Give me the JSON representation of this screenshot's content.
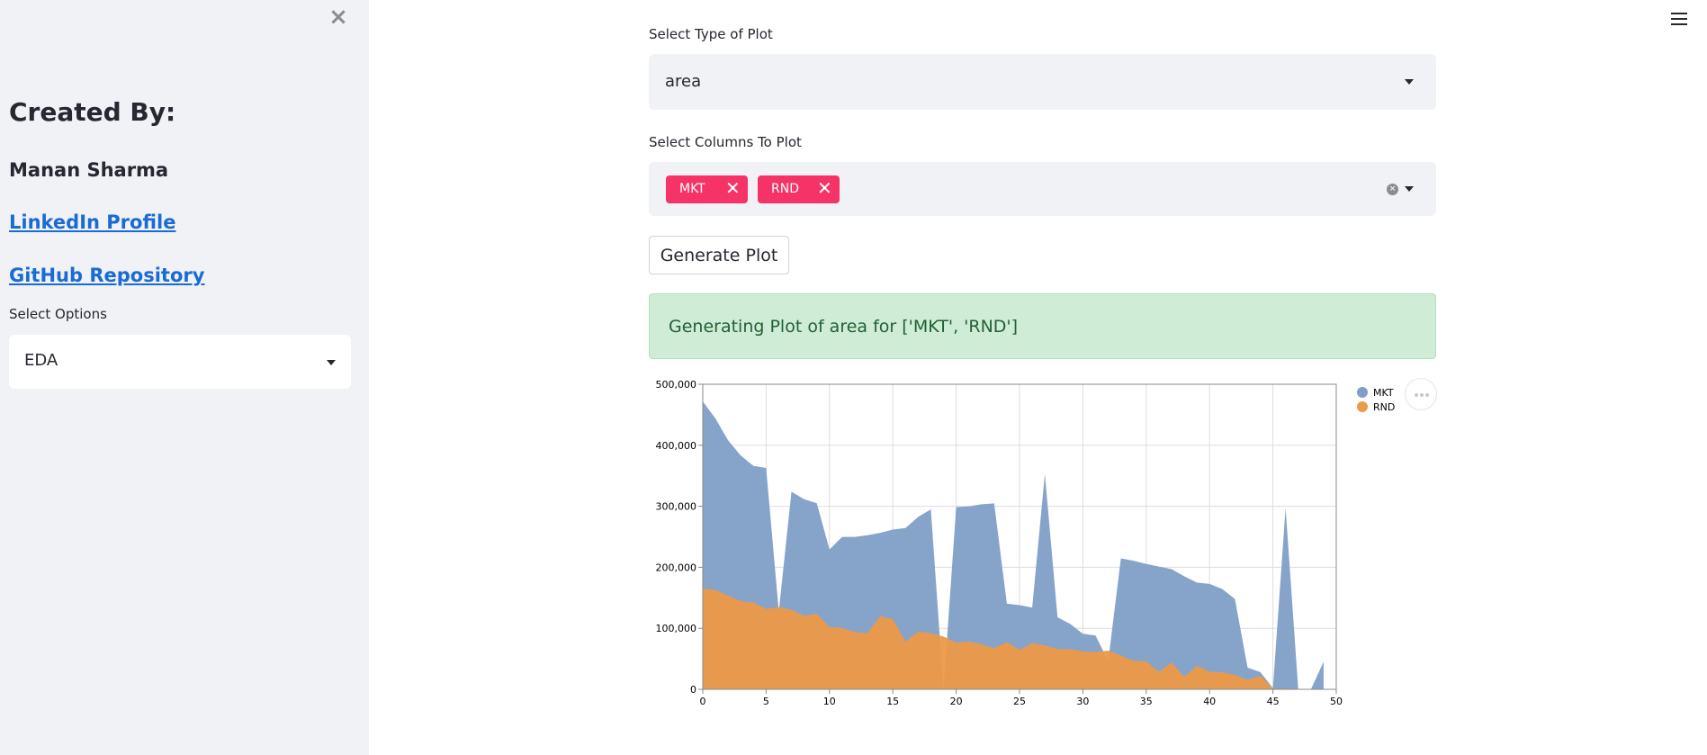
{
  "sidebar": {
    "title": "Created By:",
    "author": "Manan Sharma",
    "linkedin_label": "LinkedIn Profile",
    "github_label": "GitHub Repository",
    "options_label": "Select Options",
    "options_value": "EDA",
    "close_glyph": "×"
  },
  "main": {
    "plot_type_label": "Select Type of Plot",
    "plot_type_value": "area",
    "columns_label": "Select Columns To Plot",
    "columns": [
      "MKT",
      "RND"
    ],
    "tag_remove_glyph": "✕",
    "generate_label": "Generate Plot",
    "success_message": "Generating Plot of area for ['MKT', 'RND']",
    "more_icon": "more-horizontal-icon"
  },
  "colors": {
    "sidebar_bg": "#f0f2f6",
    "tag_bg": "#f63366",
    "link": "#1a6bd4",
    "success_bg": "#cfecd6",
    "success_text": "#216134",
    "mkt": "#7f9fc6",
    "rnd": "#ec9a48"
  },
  "chart_data": {
    "type": "area",
    "x": [
      0,
      1,
      2,
      3,
      4,
      5,
      6,
      7,
      8,
      9,
      10,
      11,
      12,
      13,
      14,
      15,
      16,
      17,
      18,
      19,
      20,
      21,
      22,
      23,
      24,
      25,
      26,
      27,
      28,
      29,
      30,
      31,
      32,
      33,
      34,
      35,
      36,
      37,
      38,
      39,
      40,
      41,
      42,
      43,
      44,
      45,
      46,
      47,
      48,
      49
    ],
    "series": [
      {
        "name": "MKT",
        "color": "#7f9fc6",
        "values": [
          471784,
          443899,
          407935,
          383200,
          366168,
          362861,
          127717,
          323877,
          311614,
          304981,
          229161,
          249745,
          249839,
          252665,
          256513,
          261776,
          264346,
          282574,
          294919,
          0,
          298664,
          299737,
          303319,
          304768,
          140574,
          137962,
          134051,
          353184,
          118148,
          107138,
          91131,
          88219,
          46085,
          214635,
          210798,
          205518,
          201127,
          197029,
          185265,
          174999,
          172795,
          164471,
          148001,
          35534,
          28335,
          1903,
          297114,
          0,
          0,
          45173
        ]
      },
      {
        "name": "RND",
        "color": "#ec9a48",
        "values": [
          165349,
          162597,
          153441,
          144372,
          142107,
          131877,
          134615,
          130298,
          120542,
          123334,
          101913,
          100671,
          93864,
          91992,
          119943,
          114523,
          78013,
          94657,
          91749,
          86419,
          76253,
          78389,
          73994,
          67532,
          77044,
          64664,
          75328,
          72107,
          66051,
          65605,
          61994,
          61136,
          63408,
          55493,
          46426,
          46014,
          28663,
          44069,
          20229,
          38558,
          28754,
          27892,
          23640,
          15505,
          22177,
          1000,
          1315,
          0,
          542,
          0
        ]
      }
    ],
    "xlim": [
      0,
      50
    ],
    "ylim": [
      0,
      500000
    ],
    "x_ticks": [
      0,
      5,
      10,
      15,
      20,
      25,
      30,
      35,
      40,
      45,
      50
    ],
    "y_ticks": [
      0,
      100000,
      200000,
      300000,
      400000,
      500000
    ],
    "y_tick_labels": [
      "0",
      "100,000",
      "200,000",
      "300,000",
      "400,000",
      "500,000"
    ],
    "grid": true,
    "legend": "top-right"
  }
}
